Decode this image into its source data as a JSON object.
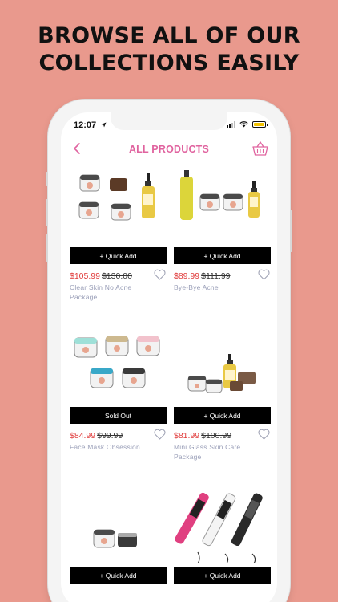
{
  "headline": [
    "BROWSE ALL OF OUR",
    "COLLECTIONS EASILY"
  ],
  "status_bar": {
    "time": "12:07"
  },
  "navbar": {
    "title": "ALL PRODUCTS",
    "back_icon": "chevron-left-icon",
    "cart_icon": "basket-icon"
  },
  "colors": {
    "background": "#e9998d",
    "accent": "#e0639f",
    "sale_price": "#e03a3a",
    "button": "#000000"
  },
  "products": [
    {
      "button": "+ Quick Add",
      "price": "$105.99",
      "old_price": "$130.00",
      "name": "Clear Skin No Acne Package"
    },
    {
      "button": "+ Quick Add",
      "price": "$89.99",
      "old_price": "$111.99",
      "name": "Bye-Bye Acne"
    },
    {
      "button": "Sold Out",
      "price": "$84.99",
      "old_price": "$99.99",
      "name": "Face Mask Obsession"
    },
    {
      "button": "+ Quick Add",
      "price": "$81.99",
      "old_price": "$100.99",
      "name": "Mini Glass Skin Care Package"
    },
    {
      "button": "+ Quick Add"
    },
    {
      "button": "+ Quick Add"
    }
  ]
}
